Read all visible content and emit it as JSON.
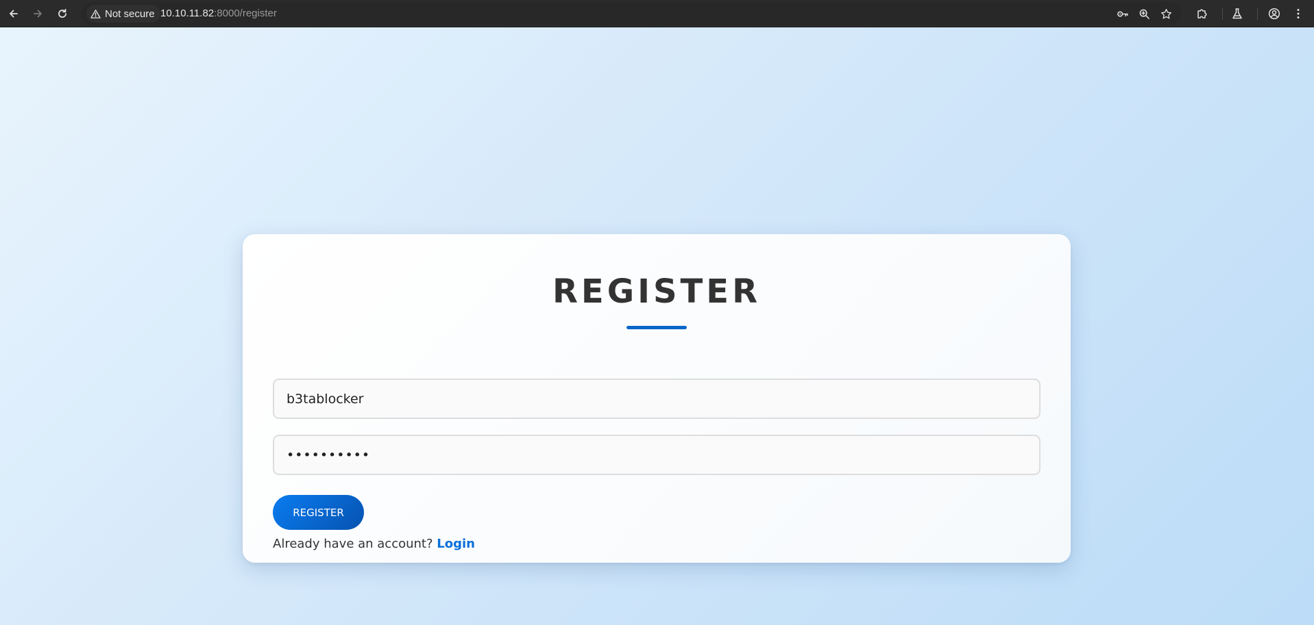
{
  "browser": {
    "security_label": "Not secure",
    "url_host": "10.10.11.82",
    "url_path": ":8000/register",
    "icons": [
      "back-arrow-icon",
      "forward-arrow-icon",
      "reload-icon",
      "warning-icon",
      "key-icon",
      "zoom-icon",
      "star-icon",
      "extensions-icon",
      "labs-flask-icon",
      "profile-icon",
      "menu-dots-icon"
    ]
  },
  "form": {
    "title": "REGISTER",
    "username_value": "b3tablocker",
    "password_value": "password12",
    "submit_label": "REGISTER",
    "login_prompt": "Already have an account?",
    "login_link": "Login"
  },
  "colors": {
    "accent": "#0a66c8",
    "link": "#0a70d8",
    "button_start": "#0a7cf0",
    "button_end": "#0653b0",
    "chrome_bg": "#2b2b2b"
  }
}
